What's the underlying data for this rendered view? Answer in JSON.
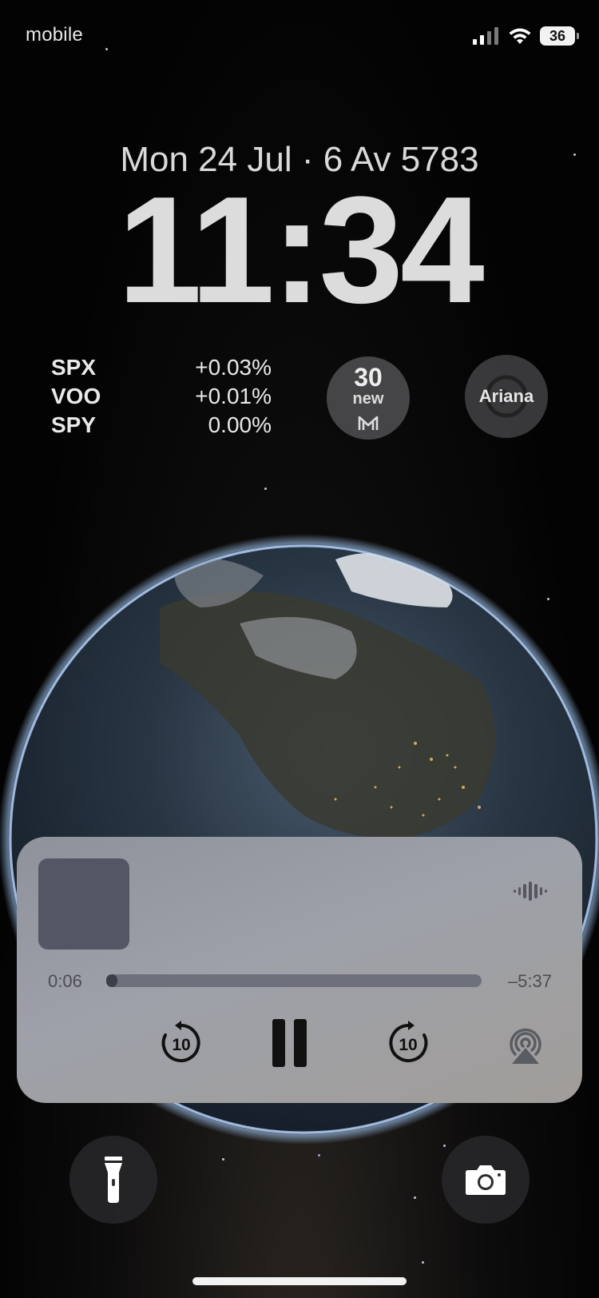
{
  "status_bar": {
    "carrier": "mobile",
    "battery": "36"
  },
  "lock_screen": {
    "date": "Mon 24 Jul · 6 Av 5783",
    "time": "11:34"
  },
  "stocks": [
    {
      "symbol": "SPX",
      "change": "+0.03%"
    },
    {
      "symbol": "VOO",
      "change": "+0.01%"
    },
    {
      "symbol": "SPY",
      "change": "0.00%"
    }
  ],
  "mail_widget": {
    "count": "30",
    "label": "new",
    "icon": "mail-m-icon"
  },
  "music_widget": {
    "label": "Ariana"
  },
  "player": {
    "elapsed": "0:06",
    "remaining": "–5:37",
    "progress": 0.017,
    "skip_back_seconds": "10",
    "skip_forward_seconds": "10",
    "artwork_color": "#535665"
  },
  "bottom_controls": {
    "left": "flashlight-icon",
    "right": "camera-icon"
  }
}
